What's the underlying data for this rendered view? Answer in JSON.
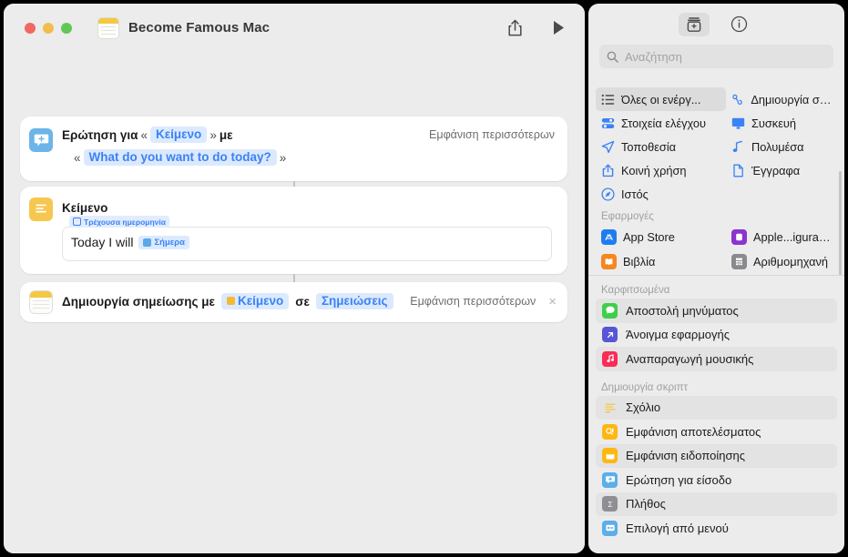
{
  "window": {
    "title": "Become Famous Mac",
    "traffic_lights": [
      "close",
      "minimize",
      "zoom"
    ],
    "toolbar": {
      "share_label": "share-icon",
      "run_label": "play-icon"
    }
  },
  "workflow": {
    "actions": [
      {
        "icon": "ask-for-input-icon",
        "line1_prefix": "Ερώτηση για",
        "line1_token": "Κείμενο",
        "line1_suffix": "με",
        "line2_token": "What do you want to do today?",
        "show_more": "Εμφάνιση περισσότερων",
        "guillemet_open": "«",
        "guillemet_close": "»"
      },
      {
        "icon": "text-icon",
        "title": "Κείμενο",
        "tooltip": "Τρέχουσα ημερομηνία",
        "field_text": "Today I will",
        "field_token": "Σήμερα"
      },
      {
        "icon": "notes-icon",
        "prefix": "Δημιουργία σημείωσης με",
        "token_text": "Κείμενο",
        "middle": "σε",
        "link_text": "Σημειώσεις",
        "show_more": "Εμφάνιση περισσότερων",
        "close": "×"
      }
    ]
  },
  "sidebar": {
    "toolbar": [
      {
        "name": "action-library-icon",
        "selected": true
      },
      {
        "name": "info-icon",
        "selected": false
      }
    ],
    "search": {
      "placeholder": "Αναζήτηση",
      "value": "",
      "icon": "search-icon"
    },
    "categories": [
      {
        "label": "Όλες οι ενέργ...",
        "icon": "list-bullet-icon",
        "selected": true
      },
      {
        "label": "Δημιουργία σκ...",
        "icon": "scripting-icon",
        "selected": false
      },
      {
        "label": "Στοιχεία ελέγχου",
        "icon": "controls-icon",
        "selected": false
      },
      {
        "label": "Συσκευή",
        "icon": "display-icon",
        "selected": false
      },
      {
        "label": "Τοποθεσία",
        "icon": "location-arrow-icon",
        "selected": false
      },
      {
        "label": "Πολυμέσα",
        "icon": "music-note-icon",
        "selected": false
      },
      {
        "label": "Κοινή χρήση",
        "icon": "share-icon",
        "selected": false
      },
      {
        "label": "Έγγραφα",
        "icon": "document-icon",
        "selected": false
      },
      {
        "label": "Ιστός",
        "icon": "safari-compass-icon",
        "selected": false
      }
    ],
    "apps_section": {
      "header": "Εφαρμογές",
      "items": [
        {
          "label": "App Store",
          "icon": "app-store-icon",
          "color": "#1f7df0"
        },
        {
          "label": "Apple...igurator",
          "icon": "apple-configurator-icon",
          "color": "#8b34cf"
        },
        {
          "label": "Βιβλία",
          "icon": "books-icon",
          "color": "#f5871f"
        },
        {
          "label": "Αριθμομηχανή",
          "icon": "calculator-icon",
          "color": "#8a8a8e"
        }
      ]
    },
    "pinned_section": {
      "header": "Καρφιτσωμένα",
      "items": [
        {
          "label": "Αποστολή μηνύματος",
          "icon": "messages-icon",
          "color": "#3fcf4a",
          "highlighted": true
        },
        {
          "label": "Άνοιγμα εφαρμογής",
          "icon": "open-app-icon",
          "color": "#5856d6",
          "highlighted": false
        },
        {
          "label": "Αναπαραγωγή μουσικής",
          "icon": "music-icon",
          "color": "#fb2b55",
          "highlighted": true
        }
      ]
    },
    "scripting_section": {
      "header": "Δημιουργία σκριπτ",
      "items": [
        {
          "label": "Σχόλιο",
          "icon": "comment-icon",
          "color": "#f6c74f",
          "highlighted": true
        },
        {
          "label": "Εμφάνιση αποτελέσματος",
          "icon": "show-result-icon",
          "color": "#fcb713",
          "highlighted": false
        },
        {
          "label": "Εμφάνιση ειδοποίησης",
          "icon": "show-alert-icon",
          "color": "#fcb713",
          "highlighted": true
        },
        {
          "label": "Ερώτηση για είσοδο",
          "icon": "ask-input-icon",
          "color": "#5aaeea",
          "highlighted": false
        },
        {
          "label": "Πλήθος",
          "icon": "count-icon",
          "color": "#8e8e93",
          "highlighted": true
        },
        {
          "label": "Επιλογή από μενού",
          "icon": "choose-menu-icon",
          "color": "#5aaeea",
          "highlighted": false
        }
      ]
    }
  },
  "colors": {
    "accent_blue": "#3b82f6",
    "token_bg": "#dbeafe",
    "window_bg": "#ececec",
    "card_bg": "#ffffff",
    "amber": "#f6c74f"
  }
}
